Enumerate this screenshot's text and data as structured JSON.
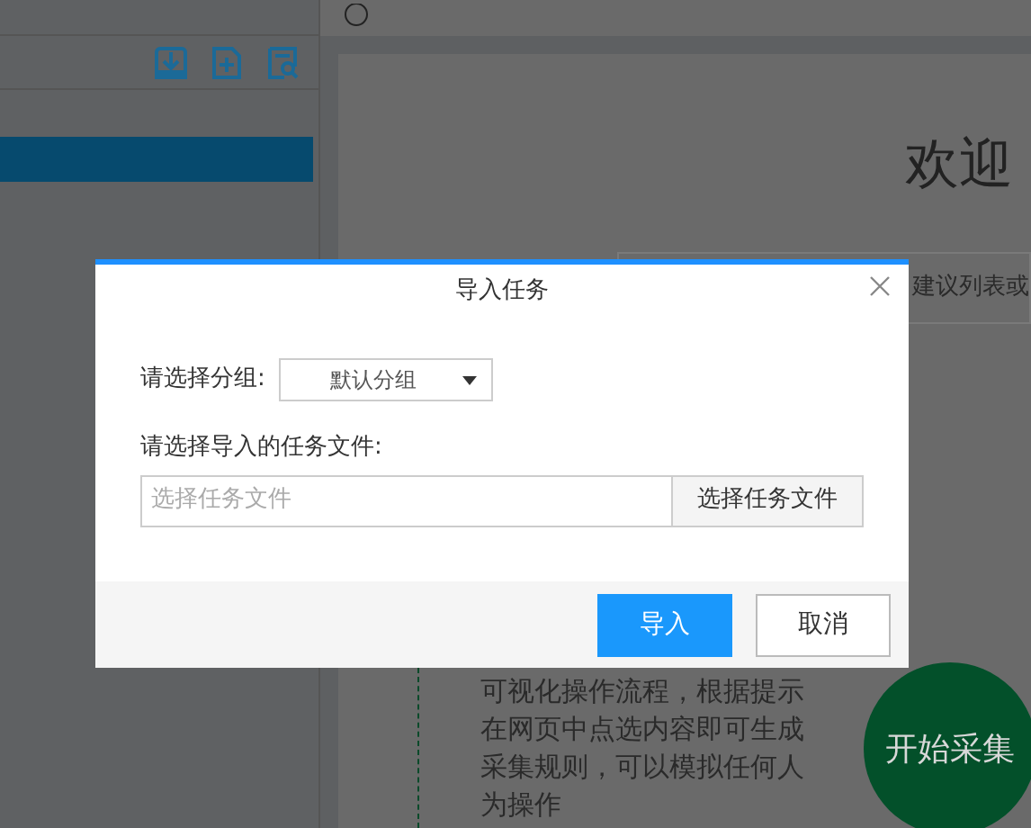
{
  "sidebar": {
    "items": [
      {
        "selected": true
      }
    ]
  },
  "main": {
    "title": "欢迎",
    "search": {
      "placeholder": "建议列表或"
    },
    "description": "可视化操作流程，根据提示在网页中点选内容即可生成采集规则，可以模拟任何人为操作",
    "start_button": "开始采集"
  },
  "dialog": {
    "title": "导入任务",
    "group_label": "请选择分组:",
    "group_value": "默认分组",
    "file_label": "请选择导入的任务文件:",
    "file_placeholder": "选择任务文件",
    "browse_button": "选择任务文件",
    "buttons": [
      {
        "label": "导入",
        "kind": "primary"
      },
      {
        "label": "取消",
        "kind": "secondary"
      }
    ]
  }
}
